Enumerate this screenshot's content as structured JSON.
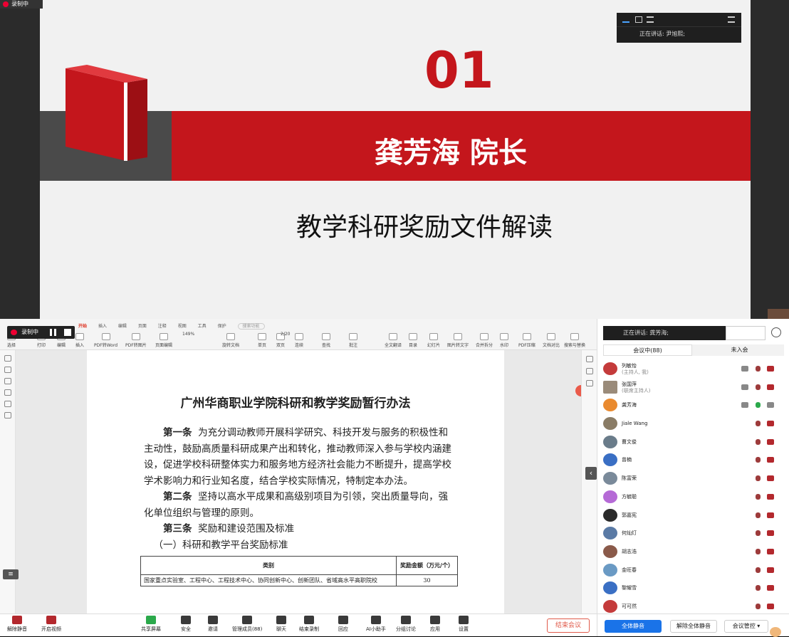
{
  "recording": {
    "label": "录制中"
  },
  "slide": {
    "number": "01",
    "presenter": "龚芳海 院长",
    "subtitle": "教学科研奖励文件解读"
  },
  "speaker_panel_top": {
    "label": "正在讲话:",
    "name": "尹旭熙;"
  },
  "pdf_toolbar": {
    "tabs": [
      "开始",
      "插入",
      "编辑",
      "页面",
      "注释",
      "视图",
      "工具",
      "保护"
    ],
    "search_placeholder": "搜索功能",
    "page_indicator": "2/20",
    "zoom": "149%",
    "items": [
      "选择",
      "打印",
      "编辑",
      "插入",
      "PDF转Word",
      "PDF转图片",
      "页面编辑",
      "旋转文档",
      "单页",
      "双页",
      "连续",
      "查找",
      "批注",
      "全文翻译",
      "目录",
      "幻灯片",
      "图片转文字",
      "合并拆分",
      "水印",
      "PDF压缩",
      "文档对比",
      "搜索与替换"
    ]
  },
  "pdf": {
    "title": "广州华商职业学院科研和教学奖励暂行办法",
    "art1_head": "第一条",
    "art1_body": "为充分调动教师开展科学研究、科技开发与服务的积极性和主动性，鼓励高质量科研成果产出和转化，推动教师深入参与学校内涵建设，促进学校科研整体实力和服务地方经济社会能力不断提升，提高学校学术影响力和行业知名度，结合学校实际情况，特制定本办法。",
    "art2_head": "第二条",
    "art2_body": "坚持以高水平成果和高级别项目为引领，突出质量导向，强化单位组织与管理的原则。",
    "art3_head": "第三条",
    "art3_body": "奖励和建设范围及标准",
    "sec1": "（一）科研和教学平台奖励标准",
    "table": {
      "col1": "类别",
      "col2": "奖励金额（万元/个）",
      "row1_c1": "国家重点实验室、工程中心、工程技术中心、协同创新中心、创新团队、省域高水平高职院校",
      "row1_c2": "30"
    }
  },
  "meeting_bar": {
    "mute": "解除静音",
    "video": "开启视频",
    "share": "共享屏幕",
    "security": "安全",
    "invite": "邀请",
    "members": "管理成员(88)",
    "chat": "聊天",
    "end_record": "结束录制",
    "react": "回应",
    "ai": "AI小助手",
    "breakout": "分组讨论",
    "apps": "应用",
    "settings": "设置",
    "end_meeting": "结束会议"
  },
  "participants": {
    "speaking_label": "正在讲话:",
    "speaking_name": "龚芳海;",
    "tab_in": "会议中(88)",
    "tab_out": "未入会",
    "list": [
      {
        "name": "列敏怡",
        "role": "(主持人, 我)"
      },
      {
        "name": "张国萍",
        "role": "(联席主持人)"
      },
      {
        "name": "龚芳海",
        "role": ""
      },
      {
        "name": "Jiale Wang",
        "role": ""
      },
      {
        "name": "曹文俊",
        "role": ""
      },
      {
        "name": "曾楠",
        "role": ""
      },
      {
        "name": "陈富荣",
        "role": ""
      },
      {
        "name": "方毓聪",
        "role": ""
      },
      {
        "name": "郭嘉宪",
        "role": ""
      },
      {
        "name": "何灿灯",
        "role": ""
      },
      {
        "name": "胡志浩",
        "role": ""
      },
      {
        "name": "金旺春",
        "role": ""
      },
      {
        "name": "黎耀雪",
        "role": ""
      },
      {
        "name": "可可然",
        "role": ""
      }
    ],
    "mute_all": "全体静音",
    "unmute_all": "解除全体静音",
    "control": "会议管控 ▾"
  },
  "colors": {
    "accent_red": "#c4161c",
    "primary_blue": "#1a73e8"
  }
}
